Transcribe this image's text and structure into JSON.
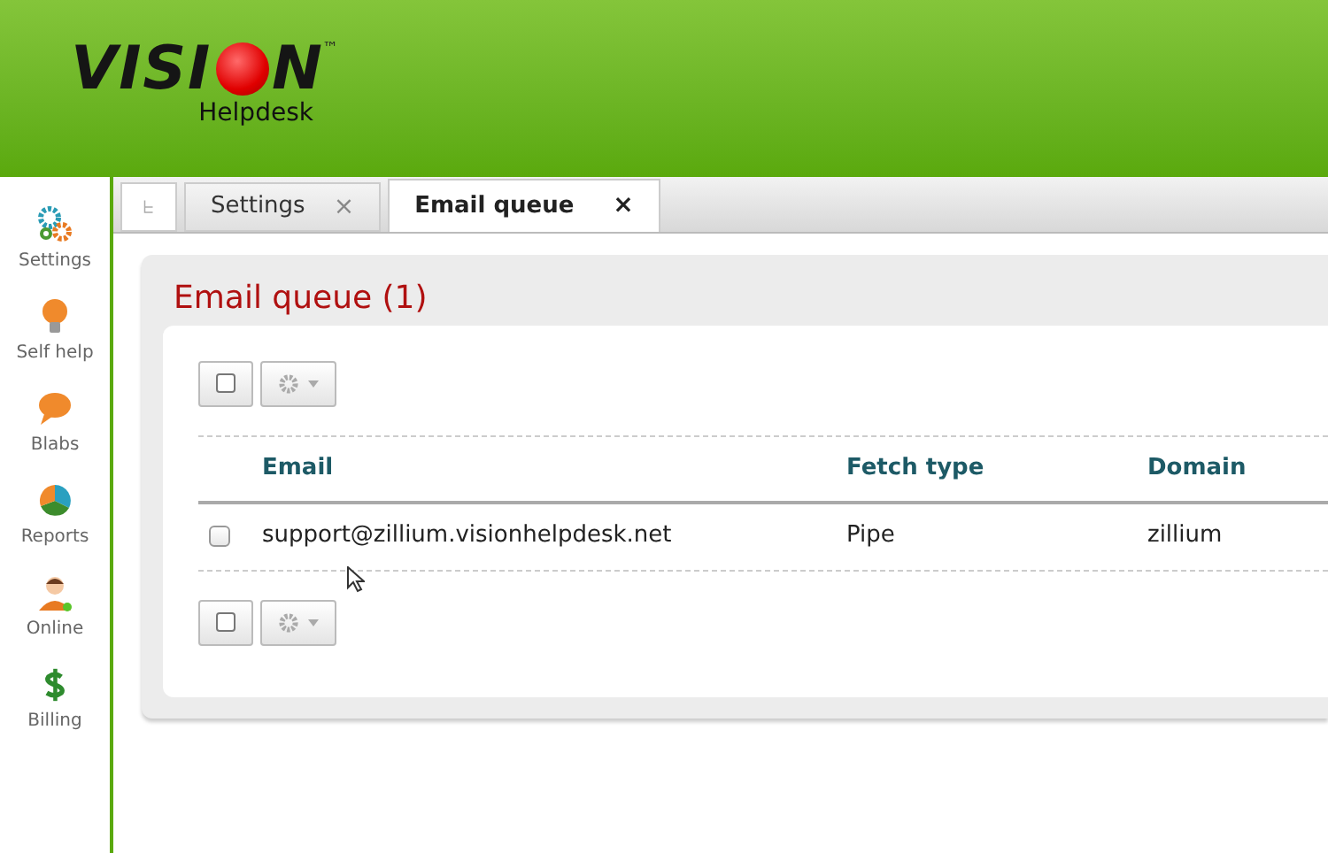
{
  "logo": {
    "text_before": "VISI",
    "text_after": "N",
    "trademark": "™",
    "subtitle": "Helpdesk"
  },
  "sidebar": {
    "items": [
      {
        "label": "Settings",
        "kind": "gears"
      },
      {
        "label": "Self help",
        "kind": "bulb"
      },
      {
        "label": "Blabs",
        "kind": "bubble"
      },
      {
        "label": "Reports",
        "kind": "pie"
      },
      {
        "label": "Online",
        "kind": "person"
      },
      {
        "label": "Billing",
        "kind": "dollar"
      }
    ]
  },
  "tabs": [
    {
      "label": "Settings",
      "close": "×",
      "selected": false
    },
    {
      "label": "Email queue",
      "close": "×",
      "selected": true
    }
  ],
  "page_title": "Email queue (1)",
  "table": {
    "columns": [
      "Email",
      "Fetch type",
      "Domain"
    ],
    "rows": [
      {
        "checked": false,
        "cells": [
          "support@zillium.visionhelpdesk.net",
          "Pipe",
          "zillium"
        ]
      }
    ]
  }
}
